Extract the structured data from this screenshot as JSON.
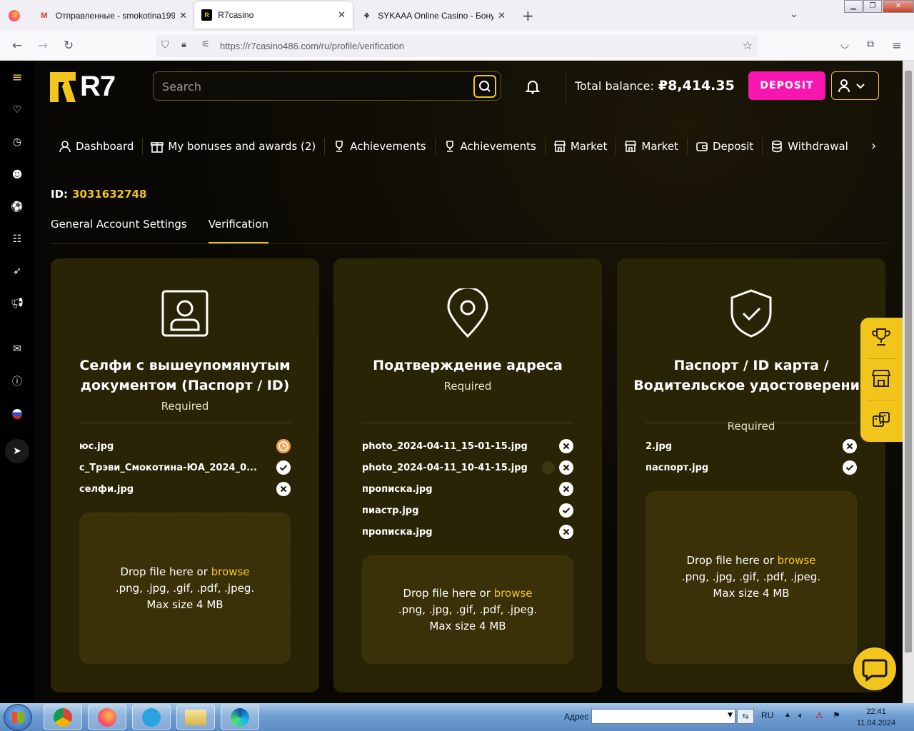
{
  "browser": {
    "tabs": [
      {
        "title": "Отправленные - smokotina199",
        "favicon": "gmail-icon",
        "active": false
      },
      {
        "title": "R7casino",
        "favicon": "r7-icon",
        "active": true
      },
      {
        "title": "SYKAAA Online Casino - Бонус",
        "favicon": "sykaaa-icon",
        "active": false
      }
    ],
    "url": "https://r7casino486.com/ru/profile/verification"
  },
  "header": {
    "logo_text": "R7",
    "search_placeholder": "Search",
    "balance_label": "Total balance:",
    "balance_value": "₽8,414.35",
    "deposit_label": "DEPOSIT"
  },
  "profile_nav": [
    {
      "label": "Dashboard",
      "icon": "user-icon"
    },
    {
      "label": "My bonuses and awards (2)",
      "icon": "gift-icon"
    },
    {
      "label": "Achievements",
      "icon": "trophy-icon"
    },
    {
      "label": "Achievements",
      "icon": "trophy-icon"
    },
    {
      "label": "Market",
      "icon": "store-icon"
    },
    {
      "label": "Market",
      "icon": "store-icon"
    },
    {
      "label": "Deposit",
      "icon": "wallet-icon"
    },
    {
      "label": "Withdrawal",
      "icon": "coins-icon"
    }
  ],
  "account": {
    "id_label": "ID:",
    "id_value": "3031632748"
  },
  "subtabs": [
    {
      "label": "General Account Settings",
      "active": false
    },
    {
      "label": "Verification",
      "active": true
    }
  ],
  "cards": [
    {
      "title": "Селфи с вышеупомянутым документом (Паспорт / ID)",
      "status": "Required",
      "icon": "id-card-icon",
      "files": [
        {
          "name": "юс.jpg",
          "state": "pending"
        },
        {
          "name": "c_Трэви_Смокотина-ЮА_2024_0...",
          "state": "approved"
        },
        {
          "name": "селфи.jpg",
          "state": "rejected"
        }
      ],
      "drop_text": "Drop file here or",
      "browse": "browse",
      "formats": ".png, .jpg, .gif, .pdf, .jpeg.",
      "max_size": "Max size 4 MB"
    },
    {
      "title": "Подтверждение адреса",
      "status": "Required",
      "icon": "location-pin-icon",
      "files": [
        {
          "name": "photo_2024-04-11_15-01-15.jpg",
          "state": "rejected"
        },
        {
          "name": "photo_2024-04-11_10-41-15.jpg",
          "state": "rejected"
        },
        {
          "name": "прописка.jpg",
          "state": "rejected"
        },
        {
          "name": "пиастр.jpg",
          "state": "approved"
        },
        {
          "name": "прописка.jpg",
          "state": "rejected"
        }
      ],
      "drop_text": "Drop file here or",
      "browse": "browse",
      "formats": ".png, .jpg, .gif, .pdf, .jpeg.",
      "max_size": "Max size 4 MB"
    },
    {
      "title": "Паспорт / ID карта / Водительское удостоверение",
      "status": "Required",
      "icon": "shield-check-icon",
      "files": [
        {
          "name": "2.jpg",
          "state": "rejected"
        },
        {
          "name": "паспорт.jpg",
          "state": "approved"
        }
      ],
      "drop_text": "Drop file here or",
      "browse": "browse",
      "formats": ".png, .jpg, .gif, .pdf, .jpeg.",
      "max_size": "Max size 4 MB"
    }
  ],
  "taskbar": {
    "address_label": "Адрес",
    "lang": "RU",
    "time": "22:41",
    "date": "11.04.2024"
  },
  "colors": {
    "accent": "#f2c51c",
    "deposit": "#f816b1",
    "card_bg": "#2a2407",
    "pending": "#f0a356"
  }
}
